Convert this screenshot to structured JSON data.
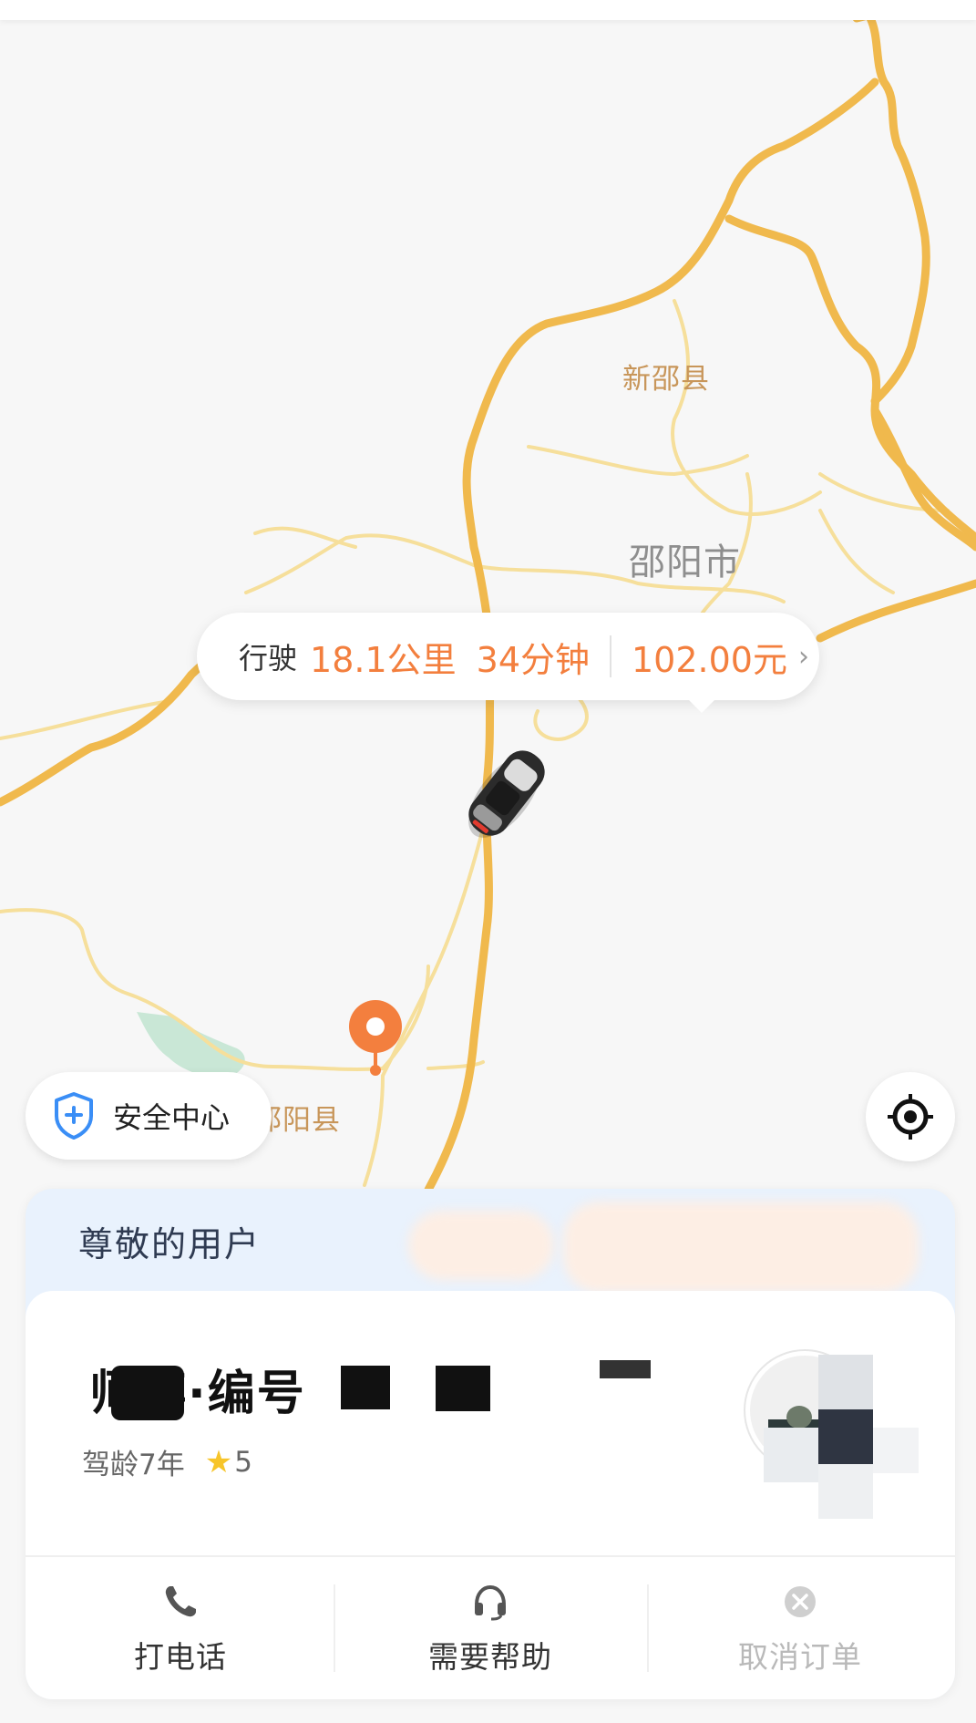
{
  "map": {
    "labels": [
      "新邵县",
      "邵阳市",
      "邵阳县"
    ],
    "route_color": "#f0b94d",
    "minor_road_color": "#f6df9b",
    "destination_pin_color": "#f37f3e"
  },
  "trip": {
    "prefix": "行驶",
    "distance": "18.1公里",
    "duration": "34分钟",
    "price": "102.00元",
    "chevron": "›"
  },
  "safety": {
    "label": "安全中心",
    "icon": "shield-plus-icon",
    "color": "#3a8ef6"
  },
  "panel": {
    "greeting": "尊敬的用户",
    "driver": {
      "name": "师傅·编号",
      "experience": "驾龄7年",
      "rating": "5"
    },
    "actions": [
      {
        "label": "打电话",
        "icon": "phone-icon"
      },
      {
        "label": "需要帮助",
        "icon": "headset-icon"
      },
      {
        "label": "取消订单",
        "icon": "cancel-icon"
      }
    ]
  },
  "colors": {
    "accent": "#f37f3e",
    "panel_header_bg": "#e9f2fd",
    "star": "#f7c52a"
  }
}
